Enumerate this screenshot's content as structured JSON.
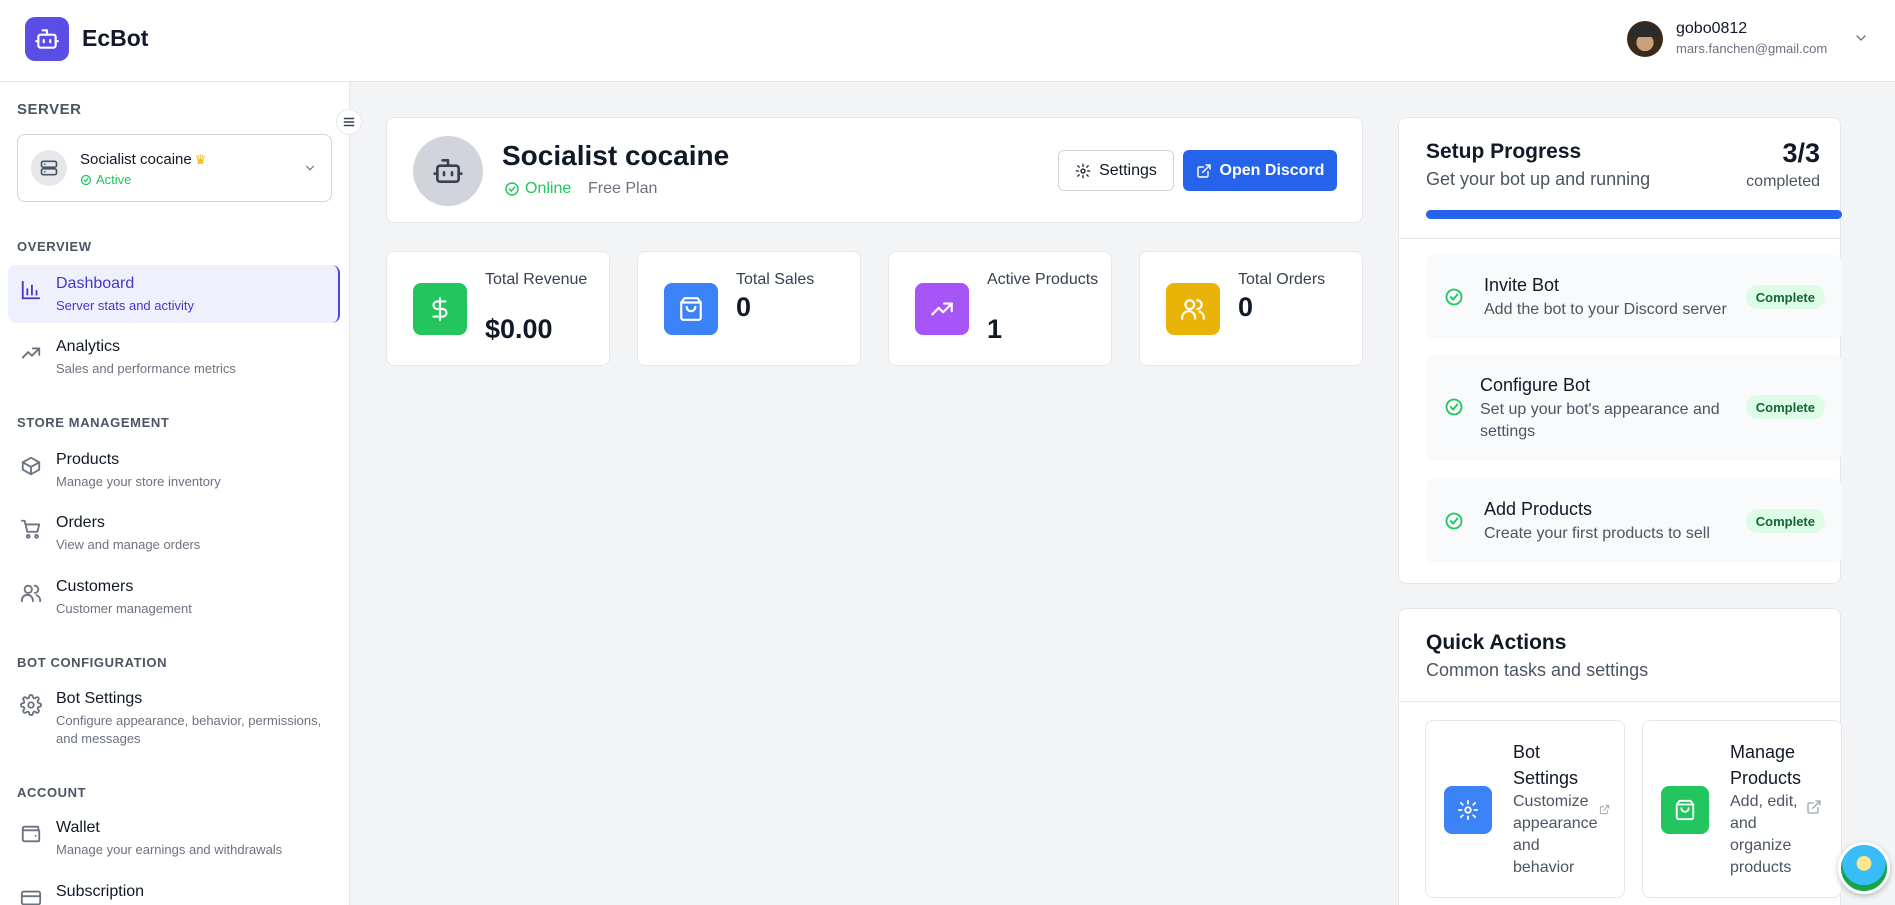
{
  "header": {
    "brand": "EcBot",
    "user_name": "gobo0812",
    "user_email": "mars.fanchen@gmail.com"
  },
  "sidebar": {
    "server_label": "SERVER",
    "server_name": "Socialist cocaine",
    "server_status": "Active",
    "sections": {
      "overview": "OVERVIEW",
      "store": "STORE MANAGEMENT",
      "bot_config": "BOT CONFIGURATION",
      "account": "ACCOUNT"
    },
    "items": [
      {
        "label": "Dashboard",
        "desc": "Server stats and activity",
        "icon": "chart-bar-icon",
        "active": true
      },
      {
        "label": "Analytics",
        "desc": "Sales and performance metrics",
        "icon": "trending-up-icon"
      },
      {
        "label": "Products",
        "desc": "Manage your store inventory",
        "icon": "box-icon"
      },
      {
        "label": "Orders",
        "desc": "View and manage orders",
        "icon": "cart-icon"
      },
      {
        "label": "Customers",
        "desc": "Customer management",
        "icon": "users-icon"
      },
      {
        "label": "Bot Settings",
        "desc": "Configure appearance, behavior, permissions, and messages",
        "icon": "gear-icon"
      },
      {
        "label": "Wallet",
        "desc": "Manage your earnings and withdrawals",
        "icon": "wallet-icon"
      },
      {
        "label": "Subscription",
        "desc": "",
        "icon": "card-icon"
      }
    ]
  },
  "server_card": {
    "title": "Socialist cocaine",
    "status": "Online",
    "plan": "Free Plan",
    "settings_label": "Settings",
    "discord_label": "Open Discord"
  },
  "stats": [
    {
      "label": "Total Revenue",
      "value": "$0.00",
      "color": "#22c55e",
      "icon": "dollar-icon"
    },
    {
      "label": "Total Sales",
      "value": "0",
      "color": "#3b82f6",
      "icon": "shopping-bag-icon"
    },
    {
      "label": "Active Products",
      "value": "1",
      "color": "#a855f7",
      "icon": "trending-up-icon"
    },
    {
      "label": "Total Orders",
      "value": "0",
      "color": "#eab308",
      "icon": "users-icon"
    }
  ],
  "setup": {
    "title": "Setup Progress",
    "subtitle": "Get your bot up and running",
    "count": "3/3",
    "count_label": "completed",
    "progress": 1.0,
    "steps": [
      {
        "title": "Invite Bot",
        "desc": "Add the bot to your Discord server",
        "badge": "Complete"
      },
      {
        "title": "Configure Bot",
        "desc": "Set up your bot's appearance and settings",
        "badge": "Complete"
      },
      {
        "title": "Add Products",
        "desc": "Create your first products to sell",
        "badge": "Complete"
      }
    ]
  },
  "quick_actions": {
    "title": "Quick Actions",
    "subtitle": "Common tasks and settings",
    "items": [
      {
        "title": "Bot Settings",
        "desc": "Customize appearance and behavior",
        "color": "#3b82f6",
        "icon": "gear-icon"
      },
      {
        "title": "Manage Products",
        "desc": "Add, edit, and organize products",
        "color": "#22c55e",
        "icon": "shopping-bag-icon"
      }
    ]
  },
  "colors": {
    "accent": "#4f46e5",
    "primary_button": "#2563eb",
    "success": "#22c55e"
  }
}
